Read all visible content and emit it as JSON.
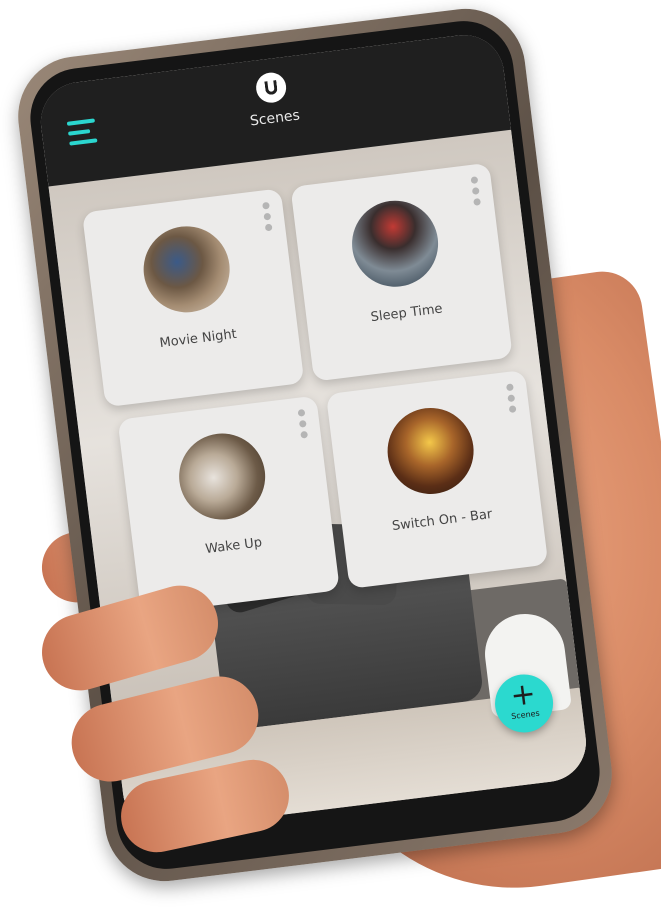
{
  "header": {
    "title": "Scenes"
  },
  "scenes": [
    {
      "label": "Movie Night"
    },
    {
      "label": "Sleep Time"
    },
    {
      "label": "Wake Up"
    },
    {
      "label": "Switch On - Bar"
    }
  ],
  "fab": {
    "symbol": "+",
    "label": "Scenes"
  },
  "colors": {
    "accent": "#2bd9cf",
    "topbar": "#1f1f1f",
    "card": "#ecebea"
  },
  "icons": {
    "menu": "hamburger-icon",
    "logo": "u-logo-icon",
    "more": "vertical-dots-icon"
  }
}
